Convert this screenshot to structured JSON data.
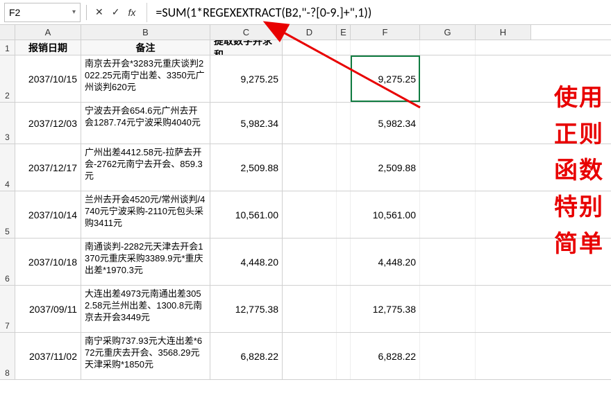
{
  "namebox": {
    "value": "F2"
  },
  "formula_bar": {
    "fx_label": "fx",
    "formula": "=SUM(1*REGEXEXTRACT(B2,\"-?[0-9.]+\",1))"
  },
  "columns": [
    "A",
    "B",
    "C",
    "D",
    "E",
    "F",
    "G",
    "H"
  ],
  "header_row": {
    "num": "1",
    "A": "报销日期",
    "B": "备注",
    "C": "提取数字并求和"
  },
  "rows": [
    {
      "num": "2",
      "date": "2037/10/15",
      "note": "南京去开会*3283元重庆谈判2022.25元南宁出差、3350元广州谈判620元",
      "c": "9,275.25",
      "f": "9,275.25"
    },
    {
      "num": "3",
      "date": "2037/12/03",
      "note": "宁波去开会654.6元广州去开会1287.74元宁波采购4040元",
      "c": "5,982.34",
      "f": "5,982.34"
    },
    {
      "num": "4",
      "date": "2037/12/17",
      "note": "广州出差4412.58元-拉萨去开会-2762元南宁去开会、859.3元",
      "c": "2,509.88",
      "f": "2,509.88"
    },
    {
      "num": "5",
      "date": "2037/10/14",
      "note": "兰州去开会4520元/常州谈判/4740元宁波采购-2110元包头采购3411元",
      "c": "10,561.00",
      "f": "10,561.00"
    },
    {
      "num": "6",
      "date": "2037/10/18",
      "note": "南通谈判-2282元天津去开会1370元重庆采购3389.9元*重庆出差*1970.3元",
      "c": "4,448.20",
      "f": "4,448.20"
    },
    {
      "num": "7",
      "date": "2037/09/11",
      "note": "大连出差4973元南通出差3052.58元兰州出差、1300.8元南京去开会3449元",
      "c": "12,775.38",
      "f": "12,775.38"
    },
    {
      "num": "8",
      "date": "2037/11/02",
      "note": "南宁采购737.93元大连出差*672元重庆去开会、3568.29元天津采购*1850元",
      "c": "6,828.22",
      "f": "6,828.22"
    }
  ],
  "annotation": {
    "line1": "使用",
    "line2": "正则",
    "line3": "函数",
    "line4": "特别",
    "line5": "简单"
  },
  "symbols": {
    "check": "✓",
    "cross": "✕",
    "dropdown": "▾"
  }
}
